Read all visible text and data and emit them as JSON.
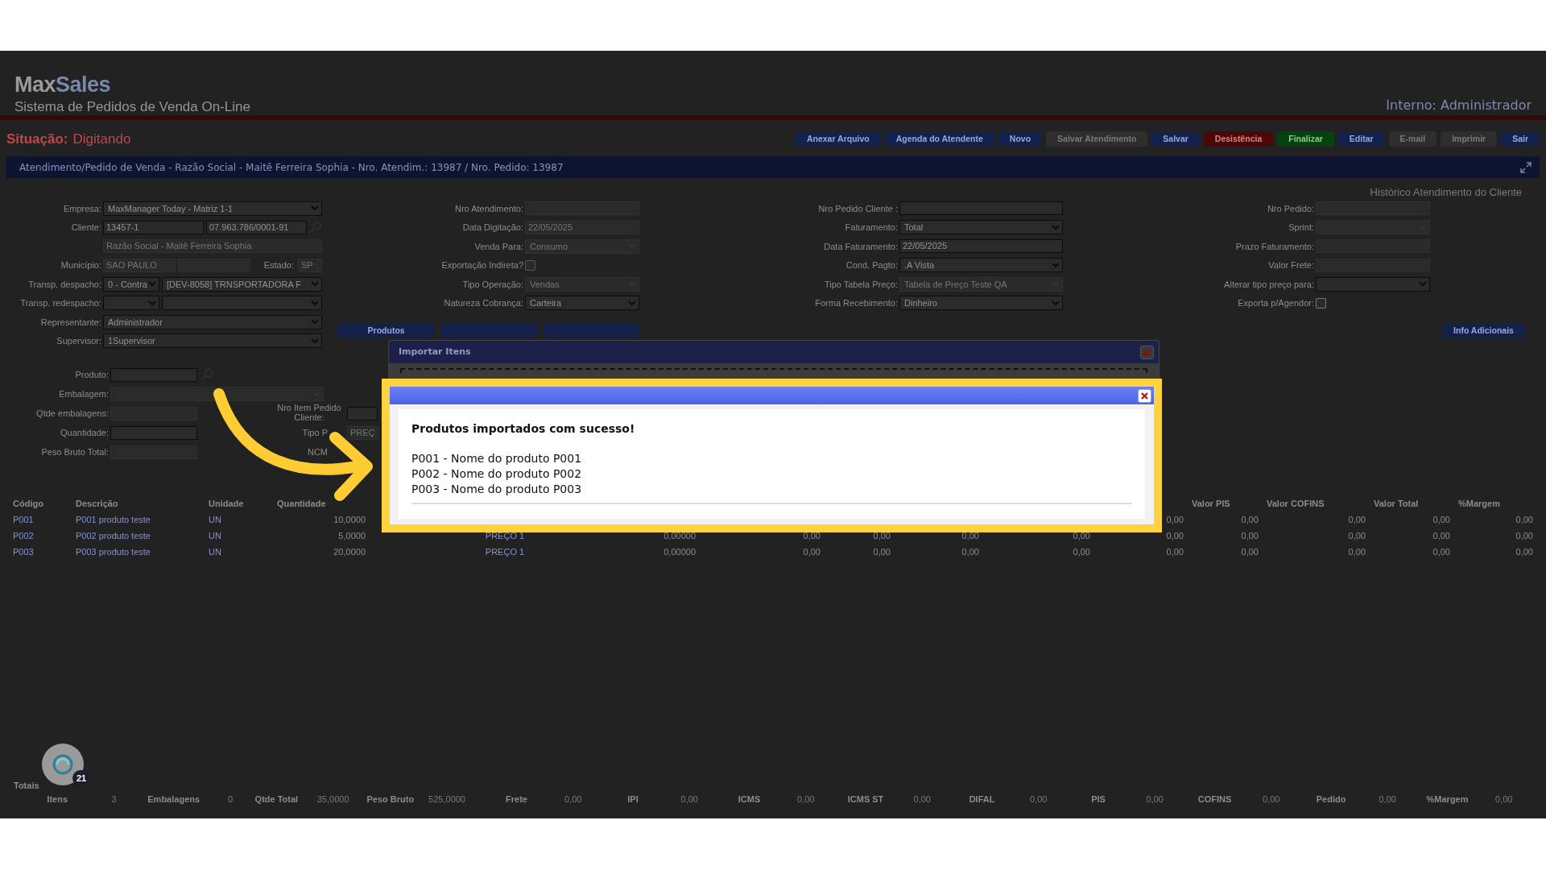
{
  "header": {
    "logo": [
      "Max",
      "Sales"
    ],
    "subtitle": "Sistema de Pedidos de Venda On-Line",
    "user": "Interno: Administrador"
  },
  "status": {
    "label": "Situação:",
    "value": "Digitando"
  },
  "toolbar": [
    {
      "label": "Anexar Arquivo",
      "kind": "primary",
      "disabled": false
    },
    {
      "label": "Agenda do Atendente",
      "kind": "primary",
      "disabled": false
    },
    {
      "label": "Novo",
      "kind": "primary",
      "disabled": false
    },
    {
      "label": "Salvar Atendimento",
      "kind": "primary",
      "disabled": true
    },
    {
      "label": "Salvar",
      "kind": "primary",
      "disabled": false
    },
    {
      "label": "Desistência",
      "kind": "danger",
      "disabled": false
    },
    {
      "label": "Finalizar",
      "kind": "success",
      "disabled": false
    },
    {
      "label": "Editar",
      "kind": "primary",
      "disabled": false
    },
    {
      "label": "E-mail",
      "kind": "primary",
      "disabled": true
    },
    {
      "label": "Imprimir",
      "kind": "primary",
      "disabled": true
    },
    {
      "label": "Sair",
      "kind": "primary",
      "disabled": false
    }
  ],
  "title_bar": "Atendimento/Pedido de Venda - Razão Social - Maitê Ferreira Sophia - Nro. Atendim.: 13987 / Nro. Pedido: 13987",
  "history_link": "Histórico Atendimento do Cliente",
  "form": {
    "columns": [
      {
        "rows": [
          {
            "label": "Empresa:",
            "controls": [
              {
                "kind": "select",
                "value": "MaxManager Today - Matriz 1-1",
                "disabled": false
              }
            ]
          },
          {
            "label": "Cliente:",
            "controls": [
              {
                "kind": "input",
                "value": "13457-1",
                "disabled": false
              },
              {
                "kind": "input",
                "value": "07.963.786/0001-91",
                "disabled": false
              },
              {
                "kind": "search"
              }
            ]
          },
          {
            "controls": [
              {
                "kind": "input",
                "value": "Razão Social - Maitê Ferreira Sophia",
                "disabled": true
              }
            ]
          },
          {
            "label": "Município:",
            "controls": [
              {
                "kind": "input",
                "value": "SAO PAULO",
                "disabled": true
              },
              {
                "kind": "input",
                "disabled": true
              },
              {
                "kind": "label",
                "value": "Estado:"
              },
              {
                "kind": "input",
                "value": "SP",
                "disabled": true
              }
            ]
          },
          {
            "label": "Transp. despacho:",
            "controls": [
              {
                "kind": "select",
                "value": "0 - Contra",
                "disabled": false
              },
              {
                "kind": "select",
                "value": "[DEV-8058] TRNSPORTADORA F",
                "disabled": false
              }
            ]
          },
          {
            "label": "Transp. redespacho:",
            "controls": [
              {
                "kind": "select",
                "disabled": false
              },
              {
                "kind": "select",
                "disabled": false
              }
            ]
          },
          {
            "label": "Representante:",
            "controls": [
              {
                "kind": "select",
                "value": "Administrador",
                "disabled": false
              }
            ]
          },
          {
            "label": "Supervisor:",
            "controls": [
              {
                "kind": "select",
                "value": "1Supervisor",
                "disabled": false
              }
            ]
          }
        ]
      },
      {
        "rows": [
          {
            "label": "Nro Atendimento:",
            "controls": [
              {
                "kind": "input",
                "disabled": true
              }
            ]
          },
          {
            "label": "Data Digitação:",
            "controls": [
              {
                "kind": "input",
                "value": "22/05/2025",
                "disabled": true
              }
            ]
          },
          {
            "label": "Venda Para:",
            "controls": [
              {
                "kind": "select",
                "value": "Consumo",
                "disabled": true
              }
            ]
          },
          {
            "label": "Exportação Indireta?",
            "controls": [
              {
                "kind": "checkbox",
                "checked": false,
                "disabled": true
              }
            ]
          },
          {
            "label": "Tipo Operação:",
            "controls": [
              {
                "kind": "select",
                "value": "Vendas",
                "disabled": true
              }
            ]
          },
          {
            "label": "Natureza Cobrança:",
            "controls": [
              {
                "kind": "select",
                "value": "Carteira",
                "disabled": false
              }
            ]
          }
        ]
      },
      {
        "rows": [
          {
            "label": "Nro Pedido Cliente :",
            "controls": [
              {
                "kind": "input",
                "disabled": false
              }
            ]
          },
          {
            "label": "Faturamento:",
            "controls": [
              {
                "kind": "select",
                "value": "Total",
                "disabled": false
              }
            ]
          },
          {
            "label": "Data Faturamento:",
            "controls": [
              {
                "kind": "input",
                "value": "22/05/2025",
                "disabled": false
              }
            ]
          },
          {
            "label": "Cond. Pagto:",
            "controls": [
              {
                "kind": "select",
                "value": ".A Vista",
                "disabled": false
              }
            ]
          },
          {
            "label": "Tipo Tabela Preço:",
            "controls": [
              {
                "kind": "select",
                "value": "Tabela de Preço Teste QA",
                "disabled": true
              }
            ]
          },
          {
            "label": "Forma Recebimento:",
            "controls": [
              {
                "kind": "select",
                "value": "Dinheiro",
                "disabled": false
              }
            ]
          }
        ]
      },
      {
        "rows": [
          {
            "label": "Nro Pedido:",
            "controls": [
              {
                "kind": "input",
                "disabled": true
              }
            ]
          },
          {
            "label": "Sprint:",
            "controls": [
              {
                "kind": "select",
                "disabled": true
              }
            ]
          },
          {
            "label": "Prazo Faturamento:",
            "controls": [
              {
                "kind": "input",
                "disabled": true
              }
            ]
          },
          {
            "label": "Valor Frete:",
            "controls": [
              {
                "kind": "input",
                "disabled": true
              }
            ]
          },
          {
            "label": "Alterar tipo preço para:",
            "controls": [
              {
                "kind": "select",
                "disabled": false
              }
            ]
          },
          {
            "label": "Exporta p/Agendor:",
            "controls": [
              {
                "kind": "checkbox",
                "checked": false,
                "disabled": false
              }
            ]
          }
        ]
      }
    ]
  },
  "item_buttons": [
    {
      "label": "Produtos"
    },
    {
      "covered": true
    },
    {
      "covered": true
    }
  ],
  "info_button": "Info Adicionais",
  "product": {
    "rows": [
      {
        "label": "Produto:",
        "controls": [
          {
            "kind": "input",
            "disabled": false
          },
          {
            "kind": "search"
          }
        ]
      },
      {
        "label": "Embalagem:",
        "controls": [
          {
            "kind": "select",
            "disabled": true
          }
        ]
      },
      {
        "label": "Qtde embalagens:",
        "controls": [
          {
            "kind": "input",
            "disabled": true
          }
        ]
      },
      {
        "label": "Quantidade:",
        "controls": [
          {
            "kind": "input",
            "disabled": false
          }
        ]
      },
      {
        "label": "Peso Bruto Total:",
        "controls": [
          {
            "kind": "input",
            "disabled": true
          }
        ]
      }
    ],
    "side_rows": [
      {
        "label": "Nro Item Pedido Cliente:",
        "controls": [
          {
            "kind": "input",
            "disabled": false
          }
        ]
      },
      {
        "label": "Tipo P",
        "controls": [
          {
            "kind": "input",
            "value": "PREÇ",
            "disabled": true
          }
        ]
      },
      {
        "label": "NCM",
        "controls": []
      }
    ]
  },
  "table": {
    "leading_columns": [
      "Código",
      "Descrição",
      "Unidade",
      "Quantidade"
    ],
    "trailing_columns": [
      "Valor PIS",
      "Valor COFINS",
      "Valor Total",
      "%Margem"
    ],
    "rows": [
      {
        "leading": [
          "P001",
          "P001 produto teste",
          "UN",
          "10,0000"
        ],
        "trailing": [
          "0,00",
          "0,00",
          "0,00",
          "0,00",
          "0,00"
        ]
      },
      {
        "leading": [
          "P002",
          "P002 produto teste",
          "UN",
          "5,0000"
        ],
        "trailing": [
          "PREÇO 1",
          "0,00000",
          "0,00",
          "0,00",
          "0,00",
          "0,00",
          "0,00",
          "0,00",
          "0,00",
          "0,00",
          "0,00"
        ]
      },
      {
        "leading": [
          "P003",
          "P003 produto teste",
          "UN",
          "20,0000"
        ],
        "trailing": [
          "PREÇO 1",
          "0,00000",
          "0,00",
          "0,00",
          "0,00",
          "0,00",
          "0,00",
          "0,00",
          "0,00",
          "0,00",
          "0,00"
        ]
      }
    ]
  },
  "totals": {
    "title": "Totais",
    "items": [
      {
        "label": "Itens",
        "value": "3"
      },
      {
        "label": "Embalagens",
        "value": "0"
      },
      {
        "label": "Qtde Total",
        "value": "35,0000"
      },
      {
        "label": "Peso Bruto",
        "value": "525,0000"
      },
      {
        "label": "Frete",
        "value": "0,00"
      },
      {
        "label": "IPI",
        "value": "0,00"
      },
      {
        "label": "ICMS",
        "value": "0,00"
      },
      {
        "label": "ICMS ST",
        "value": "0,00"
      },
      {
        "label": "DIFAL",
        "value": "0,00"
      },
      {
        "label": "PIS",
        "value": "0,00"
      },
      {
        "label": "COFINS",
        "value": "0,00"
      },
      {
        "label": "Pedido",
        "value": "0,00"
      },
      {
        "label": "%Margem",
        "value": "0,00"
      }
    ]
  },
  "chat_badge": "21",
  "import_dialog": {
    "title": "Importar Itens"
  },
  "success_dialog": {
    "heading": "Produtos importados com sucesso!",
    "lines": [
      "P001 - Nome do produto P001",
      "P002 - Nome do produto P002",
      "P003 - Nome do produto P003"
    ]
  }
}
